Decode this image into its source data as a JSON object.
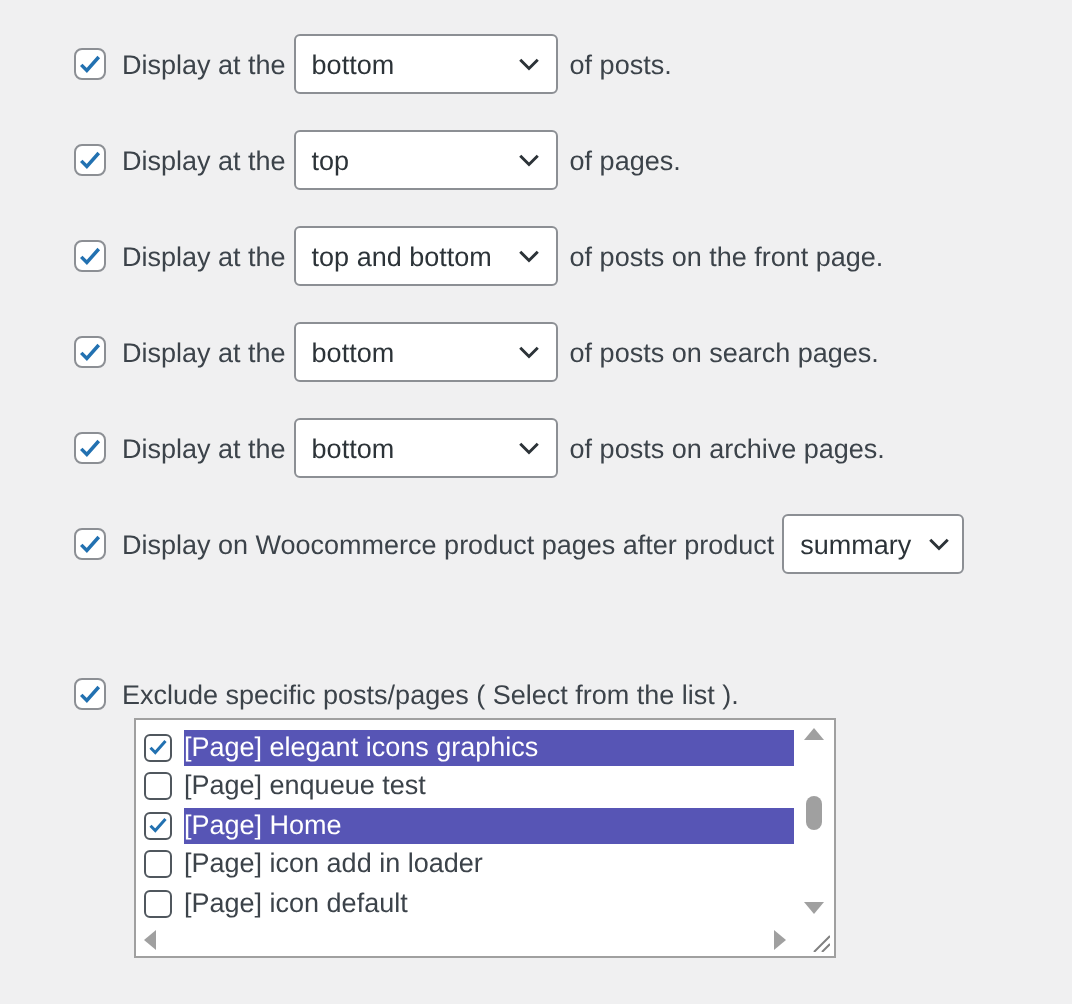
{
  "options": [
    {
      "checked": true,
      "label": "Display at the",
      "select": "bottom",
      "suffix": "of posts."
    },
    {
      "checked": true,
      "label": "Display at the",
      "select": "top",
      "suffix": "of pages."
    },
    {
      "checked": true,
      "label": "Display at the",
      "select": "top and bottom",
      "suffix": "of posts on the front page."
    },
    {
      "checked": true,
      "label": "Display at the",
      "select": "bottom",
      "suffix": "of posts on search pages."
    },
    {
      "checked": true,
      "label": "Display at the",
      "select": "bottom",
      "suffix": "of posts on archive pages."
    },
    {
      "checked": true,
      "label": "Display on Woocommerce product pages after product",
      "select": "summary"
    }
  ],
  "exclude": {
    "checked": true,
    "label": "Exclude specific posts/pages ( Select from the list ).",
    "items": [
      {
        "label": "[Page] elegant icons graphics",
        "checked": true,
        "selected": true
      },
      {
        "label": "[Page] enqueue test",
        "checked": false,
        "selected": false
      },
      {
        "label": "[Page] Home",
        "checked": true,
        "selected": true
      },
      {
        "label": "[Page] icon add in loader",
        "checked": false,
        "selected": false
      },
      {
        "label": "[Page] icon default",
        "checked": false,
        "selected": false
      }
    ]
  }
}
